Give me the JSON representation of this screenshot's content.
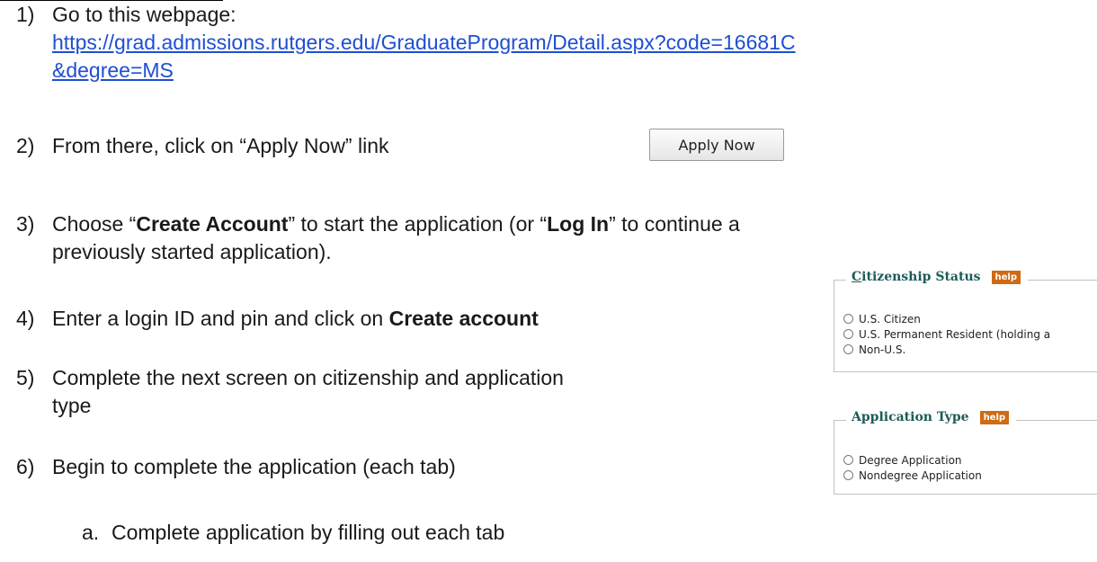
{
  "steps": [
    {
      "num": "1)",
      "text": "Go to this webpage:"
    },
    {
      "num": "2)",
      "text": "From there, click on “Apply Now” link"
    },
    {
      "num": "3)",
      "text_a": "Choose “",
      "bold_a": "Create Account",
      "text_b": "” to start the application (or “",
      "bold_b": "Log In",
      "text_c": "” to continue a",
      "line2": "previously started application)."
    },
    {
      "num": "4)",
      "text": "Enter a login ID and pin and click on ",
      "bold": "Create account"
    },
    {
      "num": "5)",
      "text": "Complete the next screen on citizenship and application",
      "line2": "type"
    },
    {
      "num": "6)",
      "text": "Begin to complete the application (each tab)"
    }
  ],
  "link": {
    "line1": "https://grad.admissions.rutgers.edu/GraduateProgram/Detail.aspx?code=16681C",
    "line2": "&degree=MS"
  },
  "substep": {
    "num": "a.",
    "text": "Complete application by filling out each tab"
  },
  "apply_button": {
    "label": "Apply Now"
  },
  "citizenship": {
    "title_u": "C",
    "title_rest": "itizenship Status",
    "help": "help",
    "options": [
      "U.S. Citizen",
      "U.S. Permanent Resident (holding a",
      "Non-U.S."
    ]
  },
  "application_type": {
    "title": "Application Type",
    "help": "help",
    "options": [
      "Degree Application",
      "Nondegree Application"
    ]
  },
  "colors": {
    "link": "#1f4fd1",
    "heading": "#1d5b58",
    "help_badge": "#cf6a15"
  }
}
